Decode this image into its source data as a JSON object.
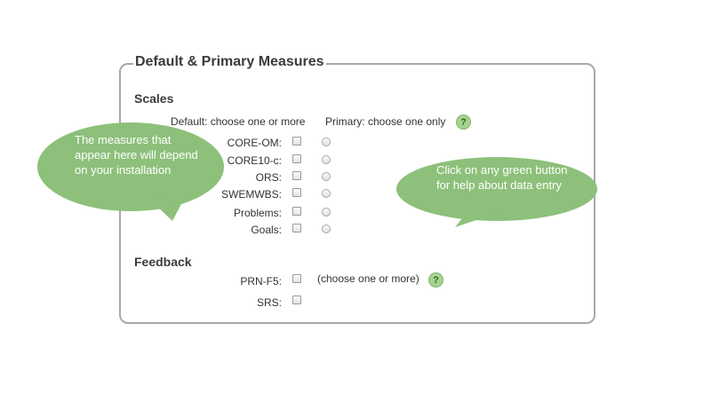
{
  "form": {
    "legend": "Default & Primary Measures",
    "scales": {
      "title": "Scales",
      "default_header": "Default: choose one or more",
      "primary_header": "Primary: choose one only",
      "help_symbol": "?",
      "rows": [
        {
          "label": "CORE-OM:"
        },
        {
          "label": "CORE10-c:"
        },
        {
          "label": "ORS:"
        },
        {
          "label": "SWEMWBS:"
        },
        {
          "label": "Problems:"
        },
        {
          "label": "Goals:"
        }
      ]
    },
    "feedback": {
      "title": "Feedback",
      "hint": "(choose one or more)",
      "help_symbol": "?",
      "rows": [
        {
          "label": "PRN-F5:"
        },
        {
          "label": "SRS:"
        }
      ]
    }
  },
  "callouts": {
    "left": "The measures that appear here will depend on your installation",
    "right": "Click on any green button for help about data entry",
    "color": "#8dc07a"
  }
}
